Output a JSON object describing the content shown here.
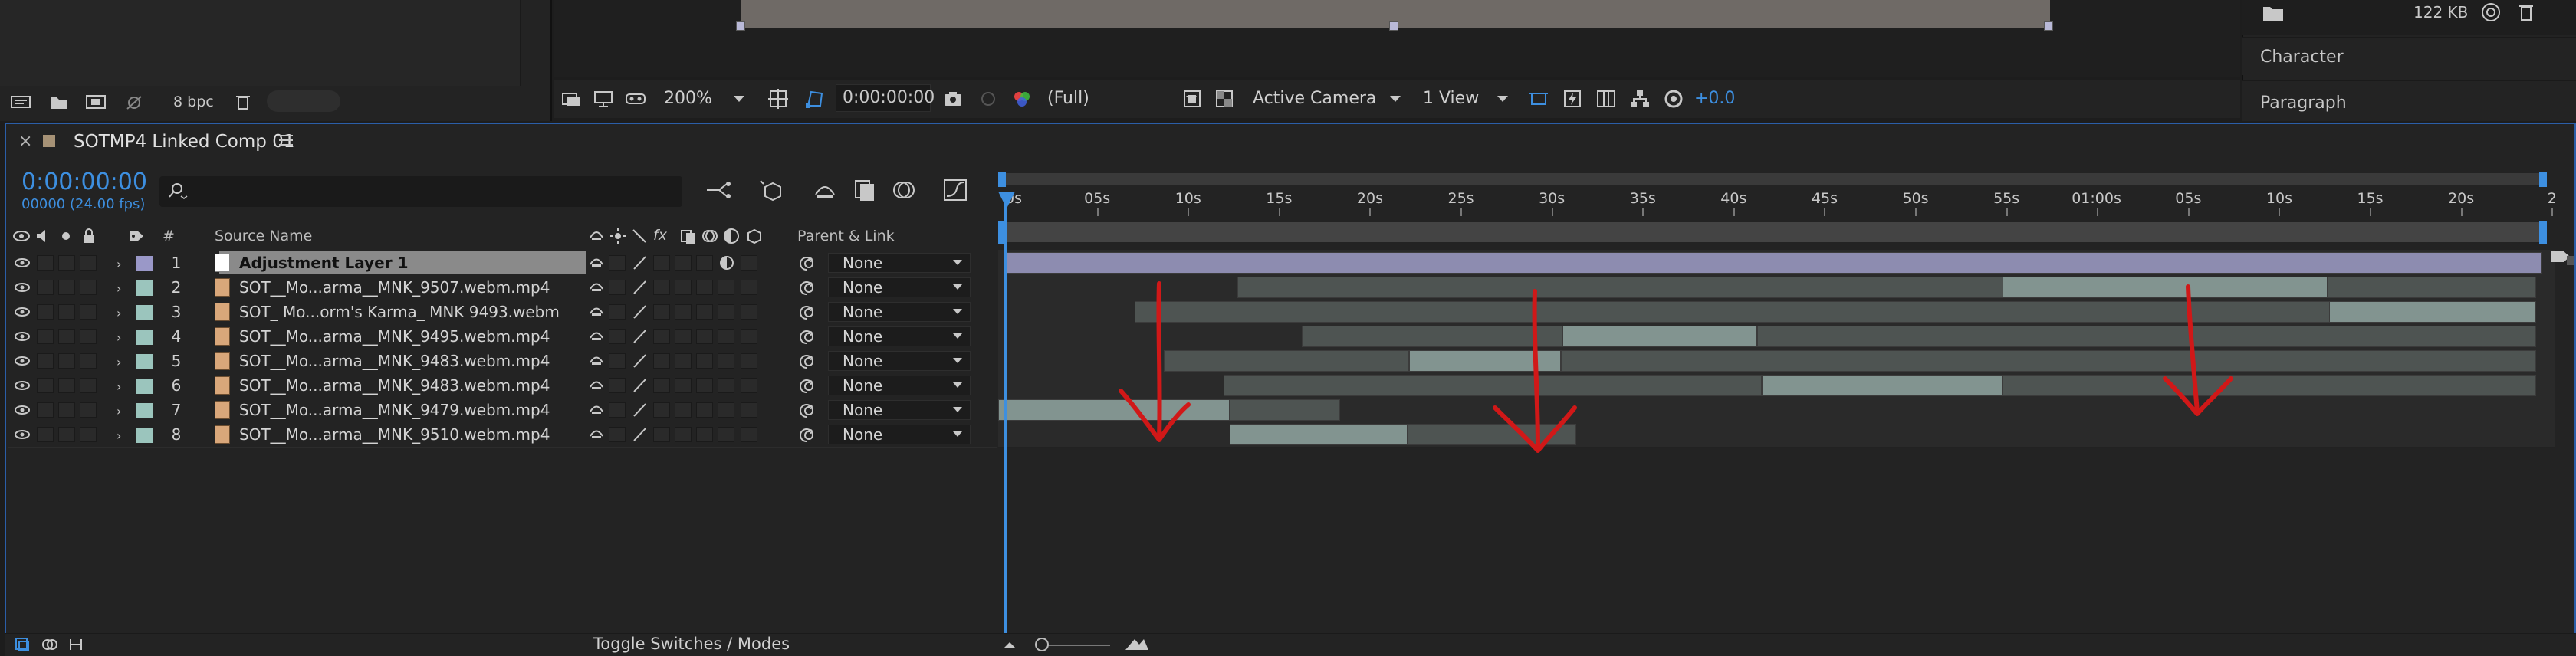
{
  "project_panel": {
    "bpc_label": "8 bpc"
  },
  "viewer_bar": {
    "zoom": "200%",
    "timecode": "0:00:00:00",
    "resolution": "(Full)",
    "camera": "Active Camera",
    "views": "1 View",
    "exposure": "+0.0"
  },
  "right_panel": {
    "file_size": "122 KB",
    "character_label": "Character",
    "paragraph_label": "Paragraph"
  },
  "timeline": {
    "comp_name": "SOTMP4 Linked Comp 01",
    "current_time": "0:00:00:00",
    "frame_info": "00000 (24.00 fps)",
    "search_placeholder": "",
    "columns": {
      "number": "#",
      "source_name": "Source Name",
      "parent_link": "Parent & Link"
    },
    "ruler_labels": [
      "0s",
      "05s",
      "10s",
      "15s",
      "20s",
      "25s",
      "30s",
      "35s",
      "40s",
      "45s",
      "50s",
      "55s",
      "01:00s",
      "05s",
      "10s",
      "15s",
      "20s",
      "2"
    ],
    "toggle_label": "Toggle Switches / Modes",
    "layers": [
      {
        "num": "1",
        "name": "Adjustment Layer 1",
        "parent": "None",
        "label_color": "#9a98c8",
        "selected": true
      },
      {
        "num": "2",
        "name": "SOT__Mo...arma__MNK_9507.webm.mp4",
        "parent": "None",
        "label_color": "#9bc5bd"
      },
      {
        "num": "3",
        "name": "SOT_ Mo...orm's Karma_ MNK 9493.webm",
        "parent": "None",
        "label_color": "#9bc5bd"
      },
      {
        "num": "4",
        "name": "SOT__Mo...arma__MNK_9495.webm.mp4",
        "parent": "None",
        "label_color": "#9bc5bd"
      },
      {
        "num": "5",
        "name": "SOT__Mo...arma__MNK_9483.webm.mp4",
        "parent": "None",
        "label_color": "#9bc5bd"
      },
      {
        "num": "6",
        "name": "SOT__Mo...arma__MNK_9483.webm.mp4",
        "parent": "None",
        "label_color": "#9bc5bd"
      },
      {
        "num": "7",
        "name": "SOT__Mo...arma__MNK_9479.webm.mp4",
        "parent": "None",
        "label_color": "#9bc5bd"
      },
      {
        "num": "8",
        "name": "SOT__Mo...arma__MNK_9510.webm.mp4",
        "parent": "None",
        "label_color": "#9bc5bd"
      }
    ]
  },
  "colors": {
    "accent": "#3d8fe0",
    "adjustment_bar": "#8d8cb0",
    "clip_dim": "#4e5452",
    "clip_lit": "#829490",
    "annotation_arrow": "#d01818"
  }
}
